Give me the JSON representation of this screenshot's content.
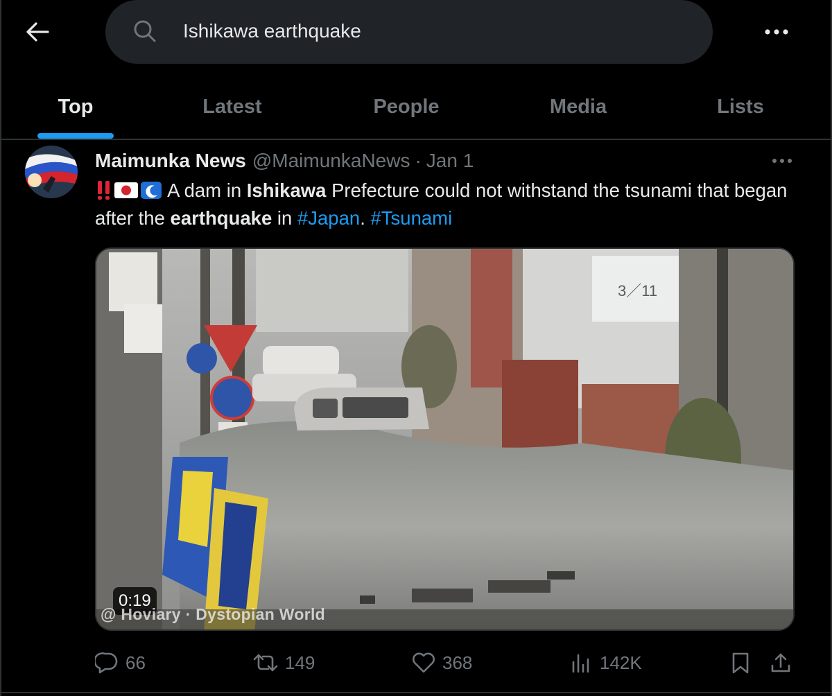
{
  "search": {
    "query": "Ishikawa earthquake"
  },
  "tabs": [
    {
      "label": "Top",
      "active": true
    },
    {
      "label": "Latest",
      "active": false
    },
    {
      "label": "People",
      "active": false
    },
    {
      "label": "Media",
      "active": false
    },
    {
      "label": "Lists",
      "active": false
    }
  ],
  "tweet": {
    "author_name": "Maimunka News",
    "author_handle": "@MaimunkaNews",
    "separator": "·",
    "date": "Jan 1",
    "emojis": [
      "double-exclamation-icon",
      "japan-flag-icon",
      "wave-icon"
    ],
    "text": {
      "t1": " A dam in ",
      "b1": "Ishikawa",
      "t2": " Prefecture could not withstand the tsunami that began after the ",
      "b2": "earthquake",
      "t3": " in ",
      "h1": "#Japan",
      "t4": ". ",
      "h2": "#Tsunami"
    },
    "media": {
      "duration": "0:19",
      "watermark": "@ Hoviary · Dystopian World",
      "sign_text": "3／11",
      "video_kind": "tsunami street footage"
    },
    "actions": {
      "replies": "66",
      "reposts": "149",
      "likes": "368",
      "views": "142K"
    }
  },
  "colors": {
    "background": "#000000",
    "text_primary": "#e7e9ea",
    "text_secondary": "#71767b",
    "accent": "#1d9bf0",
    "search_bg": "#202327",
    "border": "#2f3336"
  }
}
